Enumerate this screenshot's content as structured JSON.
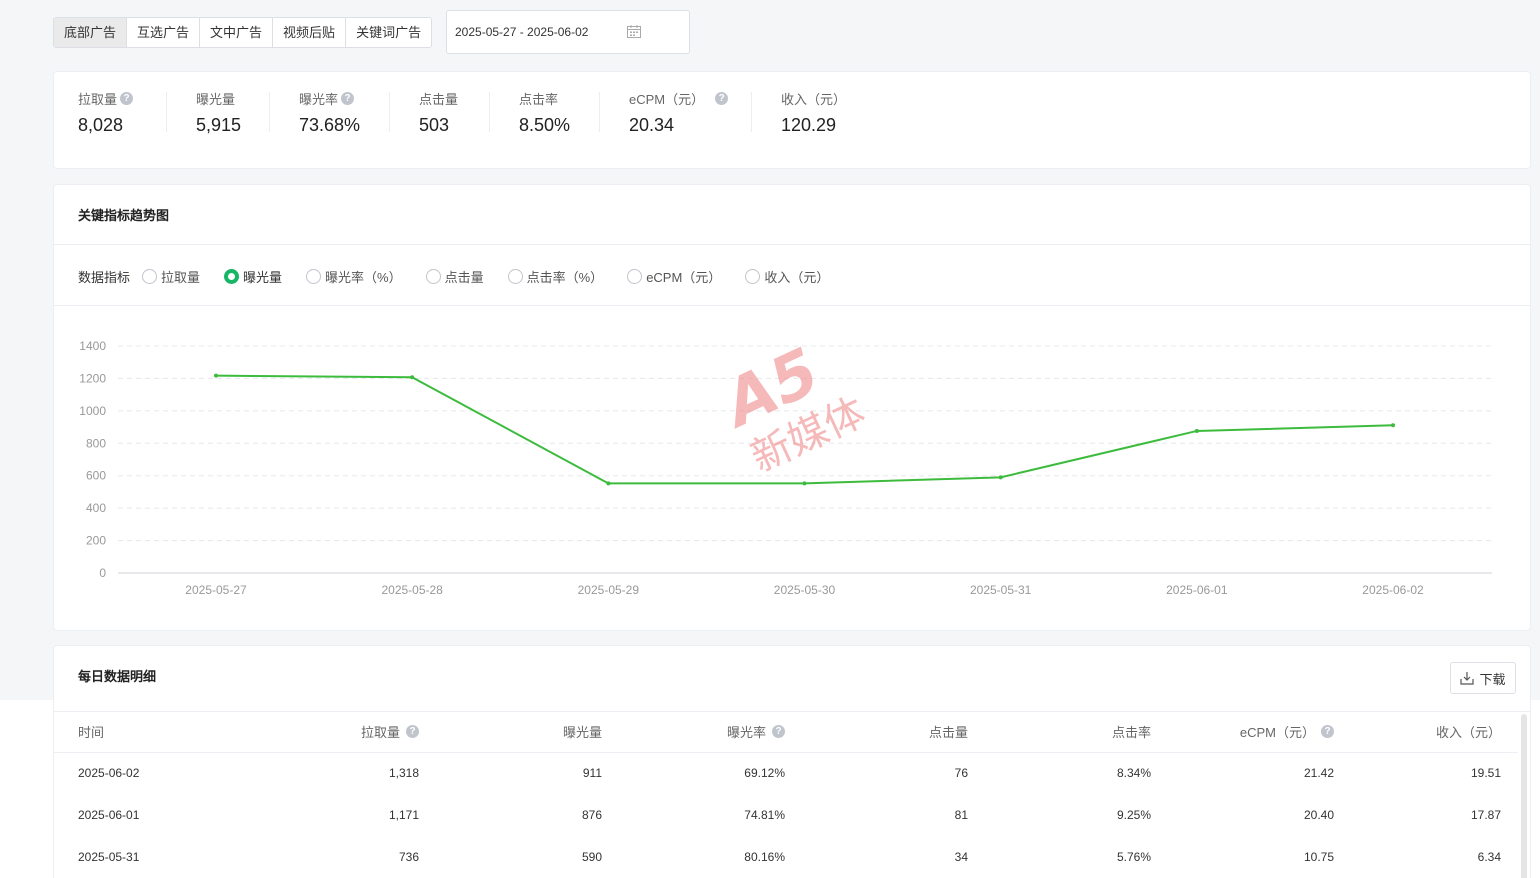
{
  "tabs": [
    "底部广告",
    "互选广告",
    "文中广告",
    "视频后贴",
    "关键词广告"
  ],
  "active_tab": 0,
  "date_range": "2025-05-27 - 2025-06-02",
  "stats": [
    {
      "label": "拉取量",
      "value": "8,028",
      "help": true
    },
    {
      "label": "曝光量",
      "value": "5,915",
      "help": false
    },
    {
      "label": "曝光率",
      "value": "73.68%",
      "help": true
    },
    {
      "label": "点击量",
      "value": "503",
      "help": false
    },
    {
      "label": "点击率",
      "value": "8.50%",
      "help": false
    },
    {
      "label": "eCPM（元）",
      "value": "20.34",
      "help": true
    },
    {
      "label": "收入（元）",
      "value": "120.29",
      "help": false
    }
  ],
  "trend": {
    "title": "关键指标趋势图",
    "metric_label": "数据指标",
    "metrics": [
      "拉取量",
      "曝光量",
      "曝光率（%）",
      "点击量",
      "点击率（%）",
      "eCPM（元）",
      "收入（元）"
    ],
    "selected_metric": 1
  },
  "chart_data": {
    "type": "line",
    "x": [
      "2025-05-27",
      "2025-05-28",
      "2025-05-29",
      "2025-05-30",
      "2025-05-31",
      "2025-06-01",
      "2025-06-02"
    ],
    "series": [
      {
        "values": [
          1217,
          1207,
          553,
          553,
          590,
          876,
          911
        ]
      }
    ],
    "ylim": [
      0,
      1400
    ],
    "yticks": [
      0,
      200,
      400,
      600,
      800,
      1000,
      1200,
      1400
    ],
    "line_color": "#3dbb3d",
    "grid": true
  },
  "table": {
    "title": "每日数据明细",
    "download_label": "下载",
    "columns": [
      {
        "label": "时间",
        "help": false
      },
      {
        "label": "拉取量",
        "help": true
      },
      {
        "label": "曝光量",
        "help": false
      },
      {
        "label": "曝光率",
        "help": true
      },
      {
        "label": "点击量",
        "help": false
      },
      {
        "label": "点击率",
        "help": false
      },
      {
        "label": "eCPM（元）",
        "help": true
      },
      {
        "label": "收入（元）",
        "help": false
      }
    ],
    "rows": [
      [
        "2025-06-02",
        "1,318",
        "911",
        "69.12%",
        "76",
        "8.34%",
        "21.42",
        "19.51"
      ],
      [
        "2025-06-01",
        "1,171",
        "876",
        "74.81%",
        "81",
        "9.25%",
        "20.40",
        "17.87"
      ],
      [
        "2025-05-31",
        "736",
        "590",
        "80.16%",
        "34",
        "5.76%",
        "10.75",
        "6.34"
      ]
    ]
  },
  "watermark": {
    "logo": "A5",
    "text": "新媒体",
    "color": "#f08080"
  }
}
